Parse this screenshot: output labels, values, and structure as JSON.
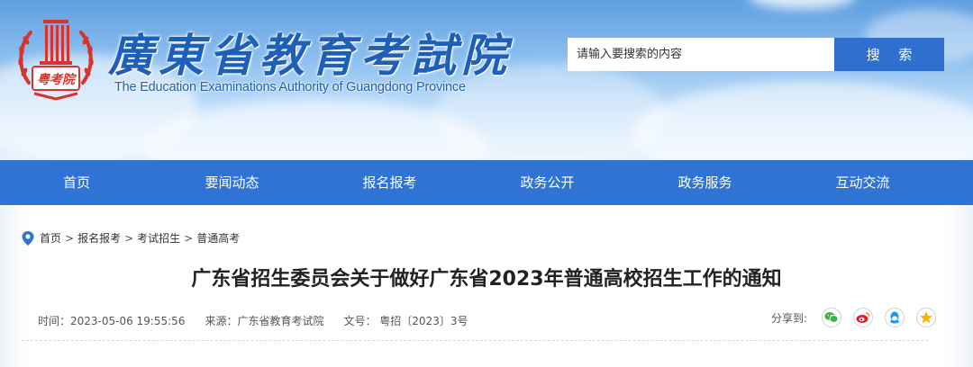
{
  "header": {
    "logo_cn": "廣東省教育考試院",
    "logo_en": "The Education Examinations Authority of Guangdong Province",
    "emblem_text": "粤考院"
  },
  "search": {
    "placeholder": "请输入要搜索的内容",
    "button_label": "搜 索"
  },
  "nav": {
    "items": [
      {
        "label": "首页"
      },
      {
        "label": "要闻动态"
      },
      {
        "label": "报名报考"
      },
      {
        "label": "政务公开"
      },
      {
        "label": "政务服务"
      },
      {
        "label": "互动交流"
      }
    ]
  },
  "breadcrumb": {
    "items": [
      "首页",
      "报名报考",
      "考试招生",
      "普通高考"
    ],
    "separator": ">"
  },
  "article": {
    "title": "广东省招生委员会关于做好广东省2023年普通高校招生工作的通知",
    "time": "时间：2023-05-06 19:55:56",
    "source": "来源：广东省教育考试院",
    "doc_no": "文号： 粤招〔2023〕3号"
  },
  "share": {
    "label": "分享到:",
    "icons": [
      "wechat-icon",
      "weibo-icon",
      "qq-icon",
      "qzone-icon"
    ]
  },
  "colors": {
    "brand_blue": "#2f74d4",
    "emblem_red": "#d9342b",
    "logo_text_blue": "#1e5fb8"
  }
}
